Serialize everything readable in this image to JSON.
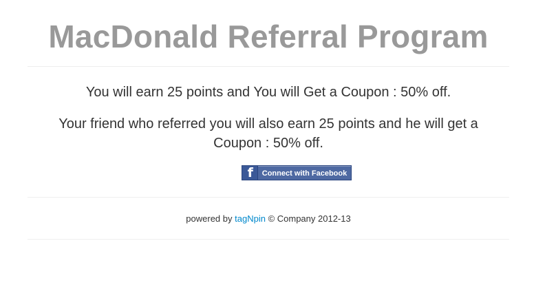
{
  "header": {
    "title": "MacDonald Referral Program"
  },
  "main": {
    "earn_text": "You will earn 25 points and You will Get a Coupon : 50% off.",
    "friend_text": "Your friend who referred you will also earn 25 points and he will get a Coupon : 50% off.",
    "facebook_button": {
      "icon": "facebook-f-icon",
      "label": "Connect with Facebook",
      "colors": {
        "background": "#4e69a2",
        "icon_background": "#3b5998",
        "border": "#29447e"
      }
    }
  },
  "footer": {
    "prefix": "powered by",
    "link_text": "tagNpin",
    "suffix": "© Company 2012-13",
    "link_color": "#0088cc"
  }
}
